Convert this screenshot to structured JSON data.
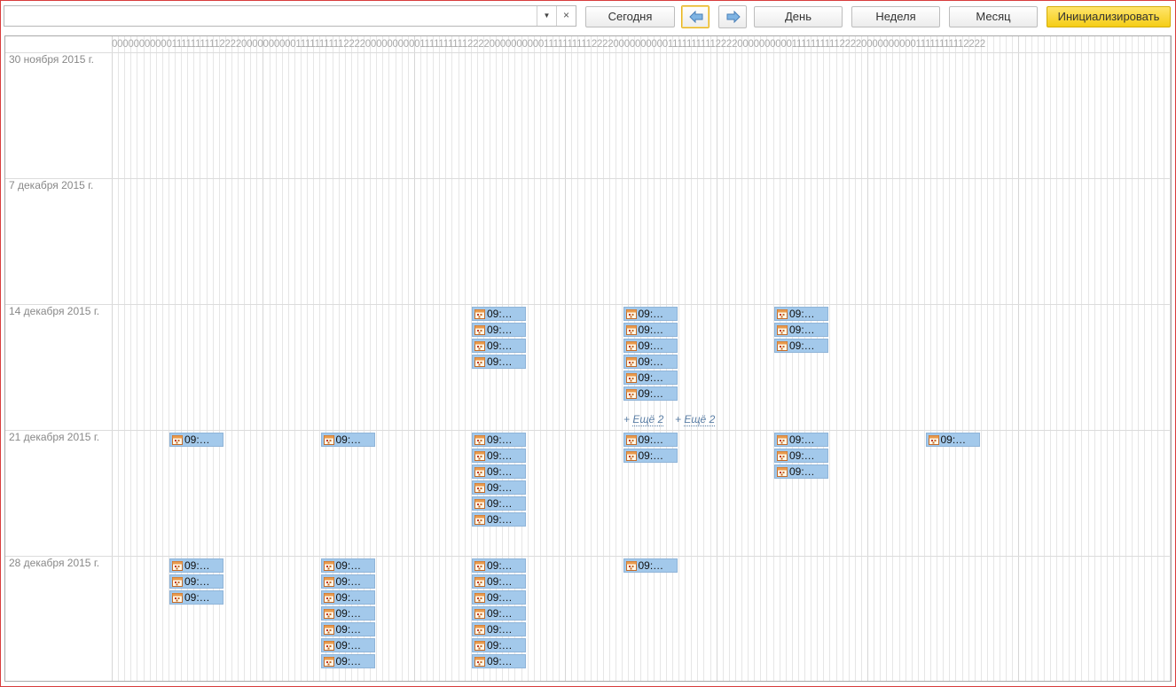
{
  "toolbar": {
    "combo_value": "",
    "today": "Сегодня",
    "day": "День",
    "week": "Неделя",
    "month": "Месяц",
    "init": "Инициализировать"
  },
  "hour_header": "0000000000011111111112222000000000011111111112222000000000011111111112222000000000011111111112222000000000011111111112222000000000011111111112222000000000011111111112222",
  "weeks": [
    {
      "label": "30 ноября 2015 г."
    },
    {
      "label": "7 декабря 2015 г."
    },
    {
      "label": "14 декабря 2015 г."
    },
    {
      "label": "21 декабря 2015 г."
    },
    {
      "label": "28 декабря 2015 г."
    }
  ],
  "event_text": "09:…",
  "more_text": "Ещё 2",
  "events": [
    {
      "week": 2,
      "day": 2,
      "count": 4
    },
    {
      "week": 2,
      "day": 3,
      "count": 6
    },
    {
      "week": 2,
      "day": 4,
      "count": 3
    },
    {
      "week": 3,
      "day": 0,
      "count": 1
    },
    {
      "week": 3,
      "day": 1,
      "count": 1
    },
    {
      "week": 3,
      "day": 2,
      "count": 6
    },
    {
      "week": 3,
      "day": 3,
      "count": 2
    },
    {
      "week": 3,
      "day": 4,
      "count": 3
    },
    {
      "week": 3,
      "day": 5,
      "count": 1
    },
    {
      "week": 4,
      "day": 0,
      "count": 3
    },
    {
      "week": 4,
      "day": 1,
      "count": 7
    },
    {
      "week": 4,
      "day": 2,
      "count": 7
    },
    {
      "week": 4,
      "day": 3,
      "count": 1
    }
  ],
  "colors": {
    "event_bg": "#a3c9eb",
    "primary_button": "#f5cd16",
    "frame_border": "#d83c3c"
  }
}
